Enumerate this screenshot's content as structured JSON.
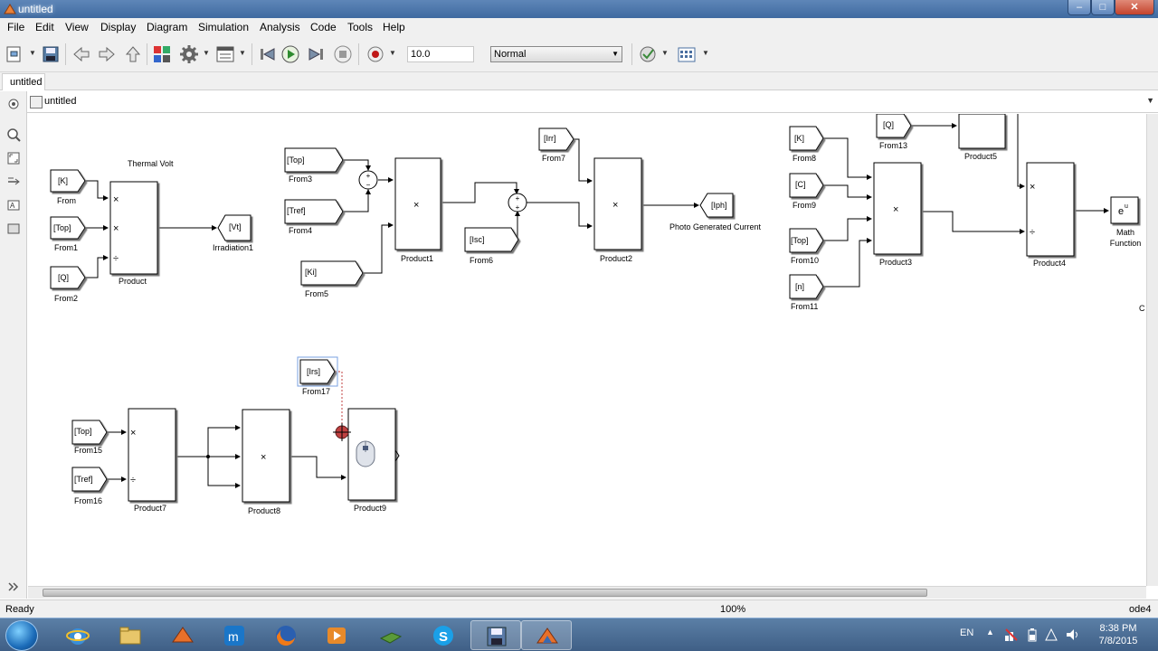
{
  "window": {
    "title": "untitled",
    "icon": "simulink-icon"
  },
  "menu": [
    "File",
    "Edit",
    "View",
    "Display",
    "Diagram",
    "Simulation",
    "Analysis",
    "Code",
    "Tools",
    "Help"
  ],
  "toolbar": {
    "stop_time": "10.0",
    "sim_mode": "Normal"
  },
  "tab": {
    "label": "untitled"
  },
  "explorer": {
    "path": "untitled"
  },
  "diagram": {
    "annotations": {
      "thermal_volt": "Thermal Volt",
      "photo_current": "Photo Generated Current",
      "right_edge": "C"
    },
    "labels": {
      "From": "From",
      "From1": "From1",
      "From2": "From2",
      "From3": "From3",
      "From4": "From4",
      "From5": "From5",
      "From6": "From6",
      "From7": "From7",
      "From8": "From8",
      "From9": "From9",
      "From10": "From10",
      "From11": "From11",
      "From13": "From13",
      "From15": "From15",
      "From16": "From16",
      "From17": "From17",
      "Product": "Product",
      "Product1": "Product1",
      "Product2": "Product2",
      "Product3": "Product3",
      "Product4": "Product4",
      "Product5": "Product5",
      "Product7": "Product7",
      "Product8": "Product8",
      "Product9": "Product9",
      "Irradiation1": "Irradiation1",
      "MathFunction": "Math Function"
    },
    "tags": {
      "From": "[K]",
      "From1": "[Top]",
      "From2": "[Q]",
      "Goto1": "[Vt]",
      "From3": "[Top]",
      "From4": "[Tref]",
      "From5": "[Ki]",
      "From6": "[Isc]",
      "From7": "[Irr]",
      "Goto2": "[Iph]",
      "From8": "[K]",
      "From9": "[C]",
      "From10": "[Top]",
      "From11": "[n]",
      "From13": "[Q]",
      "From15": "[Top]",
      "From16": "[Tref]",
      "From17": "[Irs]"
    },
    "math_func": "e",
    "math_sup": "u"
  },
  "status": {
    "text": "Ready",
    "zoom": "100%",
    "solver": "ode4"
  },
  "taskbar": {
    "lang": "EN",
    "time": "8:38 PM",
    "date": "7/8/2015"
  }
}
